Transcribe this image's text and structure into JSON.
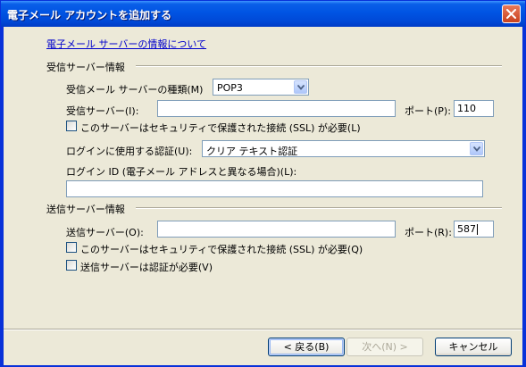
{
  "window": {
    "title": "電子メール アカウントを追加する"
  },
  "info_link": "電子メール サーバーの情報について",
  "incoming": {
    "section_label": "受信サーバー情報",
    "type_label": "受信メール サーバーの種類(M)",
    "type_value": "POP3",
    "server_label": "受信サーバー(I):",
    "server_value": "",
    "port_label": "ポート(P):",
    "port_value": "110",
    "ssl_label": "このサーバーはセキュリティで保護された接続 (SSL) が必要(L)",
    "auth_label": "ログインに使用する認証(U):",
    "auth_value": "クリア テキスト認証",
    "login_id_label": "ログイン ID (電子メール アドレスと異なる場合)(L):",
    "login_id_value": ""
  },
  "outgoing": {
    "section_label": "送信サーバー情報",
    "server_label": "送信サーバー(O):",
    "server_value": "",
    "port_label": "ポート(R):",
    "port_value": "587",
    "ssl_label": "このサーバーはセキュリティで保護された接続 (SSL) が必要(Q)",
    "auth_required_label": "送信サーバーは認証が必要(V)"
  },
  "buttons": {
    "back": "< 戻る(B)",
    "next": "次へ(N) >",
    "cancel": "キャンセル"
  },
  "icons": {
    "close": "close-icon",
    "dropdown": "chevron-down-icon"
  }
}
